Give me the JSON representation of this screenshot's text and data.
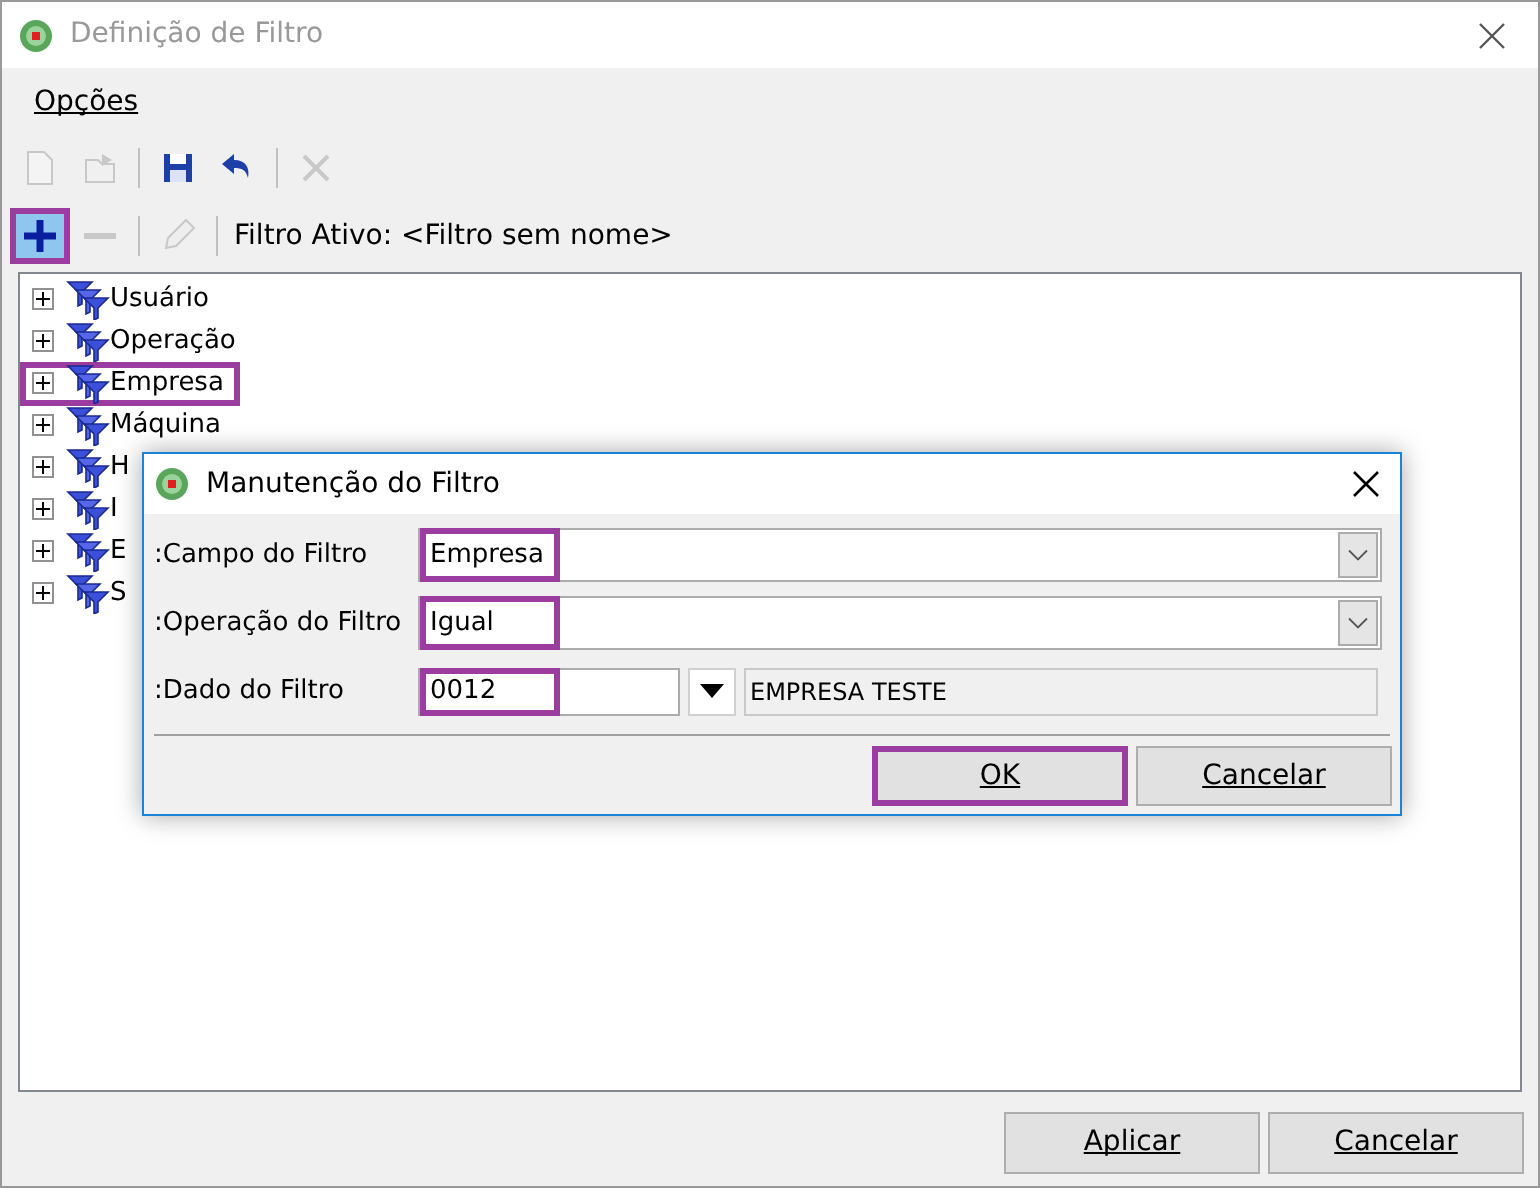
{
  "window": {
    "title": "Definição de Filtro"
  },
  "menu": [
    {
      "label": "Opções"
    }
  ],
  "toolbar": [
    {
      "kind": "new",
      "disabled": true
    },
    {
      "kind": "open",
      "disabled": true
    },
    {
      "kind": "separator"
    },
    {
      "kind": "save",
      "disabled": false
    },
    {
      "kind": "undo",
      "disabled": false
    },
    {
      "kind": "separator"
    },
    {
      "kind": "delete",
      "disabled": true
    }
  ],
  "filter_toolbar": {
    "buttons": [
      {
        "kind": "add",
        "disabled": false,
        "highlighted": true
      },
      {
        "kind": "remove",
        "disabled": true,
        "highlighted": false
      },
      {
        "kind": "separator"
      },
      {
        "kind": "edit",
        "disabled": true,
        "highlighted": false
      },
      {
        "kind": "separator"
      }
    ],
    "active_filter": "Filtro Ativo: <Filtro sem nome>"
  },
  "tree": [
    {
      "label": "Usuário",
      "expanded": false,
      "highlighted": false
    },
    {
      "label": "Operação",
      "expanded": false,
      "highlighted": false
    },
    {
      "label": "Empresa",
      "expanded": false,
      "highlighted": true
    },
    {
      "label": "Máquina",
      "expanded": false,
      "highlighted": false
    },
    {
      "label": "H",
      "expanded": false,
      "highlighted": false
    },
    {
      "label": "I",
      "expanded": false,
      "highlighted": false
    },
    {
      "label": "E",
      "expanded": false,
      "highlighted": false
    },
    {
      "label": "S",
      "expanded": false,
      "highlighted": false
    }
  ],
  "dialog": {
    "title": "Manutenção do Filtro",
    "fields": [
      {
        "kind": "combo",
        "label": ":Campo do Filtro",
        "value": "Empresa",
        "highlighted": true
      },
      {
        "kind": "combo",
        "label": ":Operação do Filtro",
        "value": "Igual",
        "highlighted": true
      },
      {
        "kind": "lookup",
        "label": ":Dado do Filtro",
        "value": "0012",
        "highlighted": true,
        "description": "EMPRESA TESTE"
      }
    ],
    "buttons": [
      {
        "label": "OK",
        "highlighted": true
      },
      {
        "label": "Cancelar",
        "highlighted": false
      }
    ]
  },
  "buttons": [
    {
      "label": "Aplicar"
    },
    {
      "label": "Cancelar"
    }
  ]
}
